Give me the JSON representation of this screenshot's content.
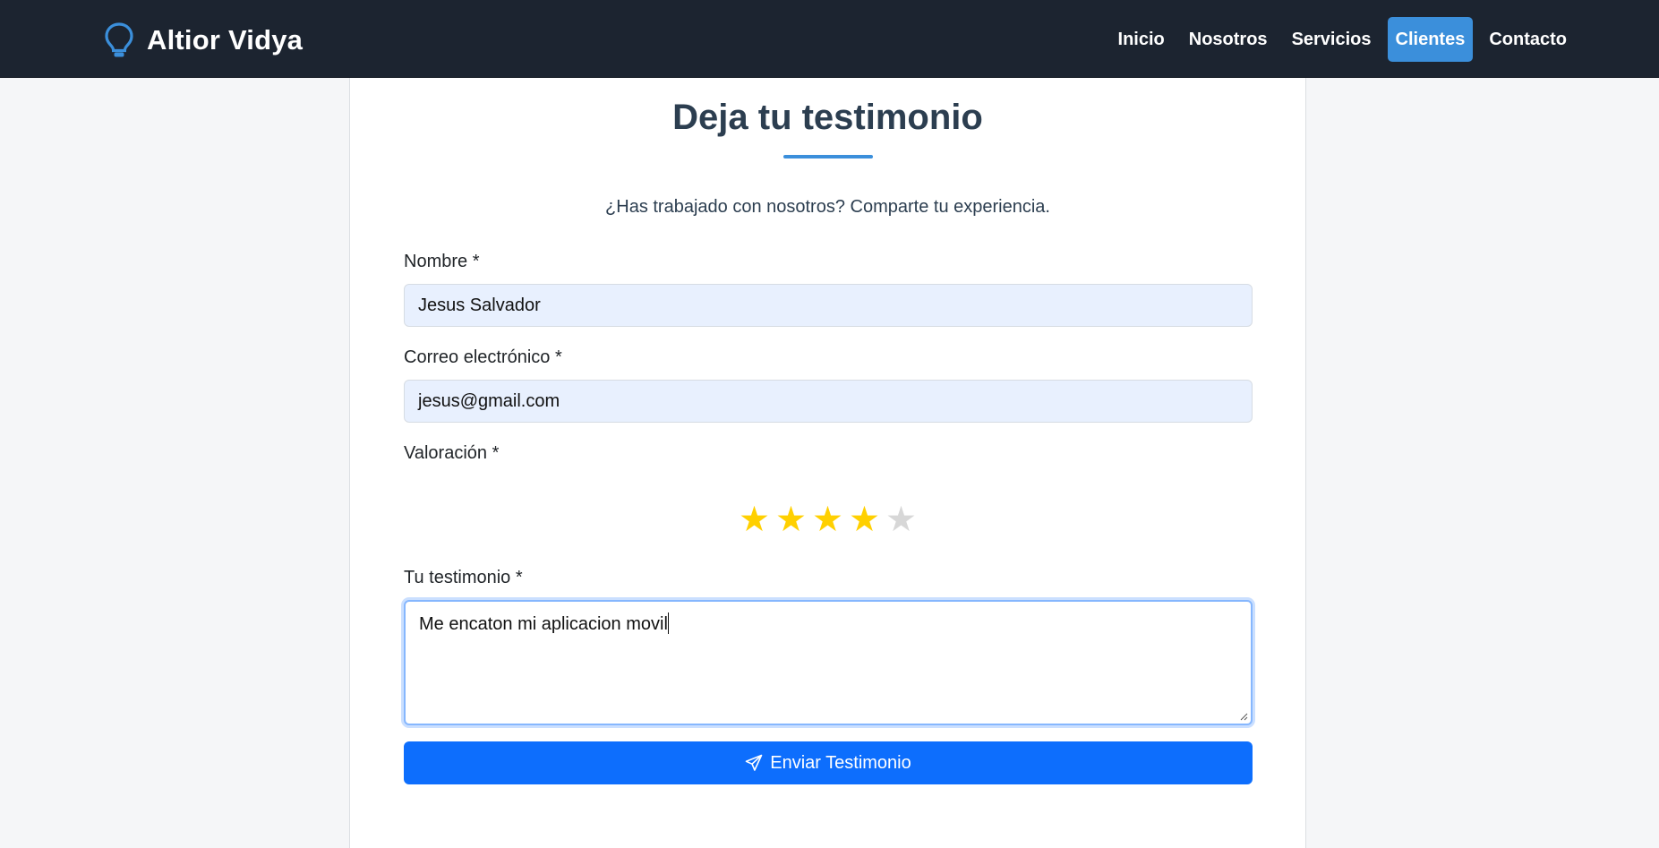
{
  "navbar": {
    "brand": "Altior Vidya",
    "brand_icon": "lightbulb-icon",
    "links": [
      {
        "label": "Inicio",
        "active": false
      },
      {
        "label": "Nosotros",
        "active": false
      },
      {
        "label": "Servicios",
        "active": false
      },
      {
        "label": "Clientes",
        "active": true
      },
      {
        "label": "Contacto",
        "active": false
      }
    ]
  },
  "form": {
    "title": "Deja tu testimonio",
    "subtitle": "¿Has trabajado con nosotros? Comparte tu experiencia.",
    "name_label": "Nombre *",
    "name_value": "Jesus Salvador",
    "email_label": "Correo electrónico *",
    "email_value": "jesus@gmail.com",
    "rating_label": "Valoración *",
    "rating": 4,
    "rating_max": 5,
    "star_glyph": "★",
    "testimonial_label": "Tu testimonio *",
    "testimonial_value": "Me encaton mi aplicacion movil",
    "submit_label": "Enviar Testimonio",
    "submit_icon": "send-icon"
  },
  "colors": {
    "navbar_bg": "#1c2430",
    "accent": "#3b8fdb",
    "primary_button": "#0d6efd",
    "star_on": "#ffd000",
    "star_off": "#d7d7d7",
    "input_bg": "#e8f0fe"
  }
}
